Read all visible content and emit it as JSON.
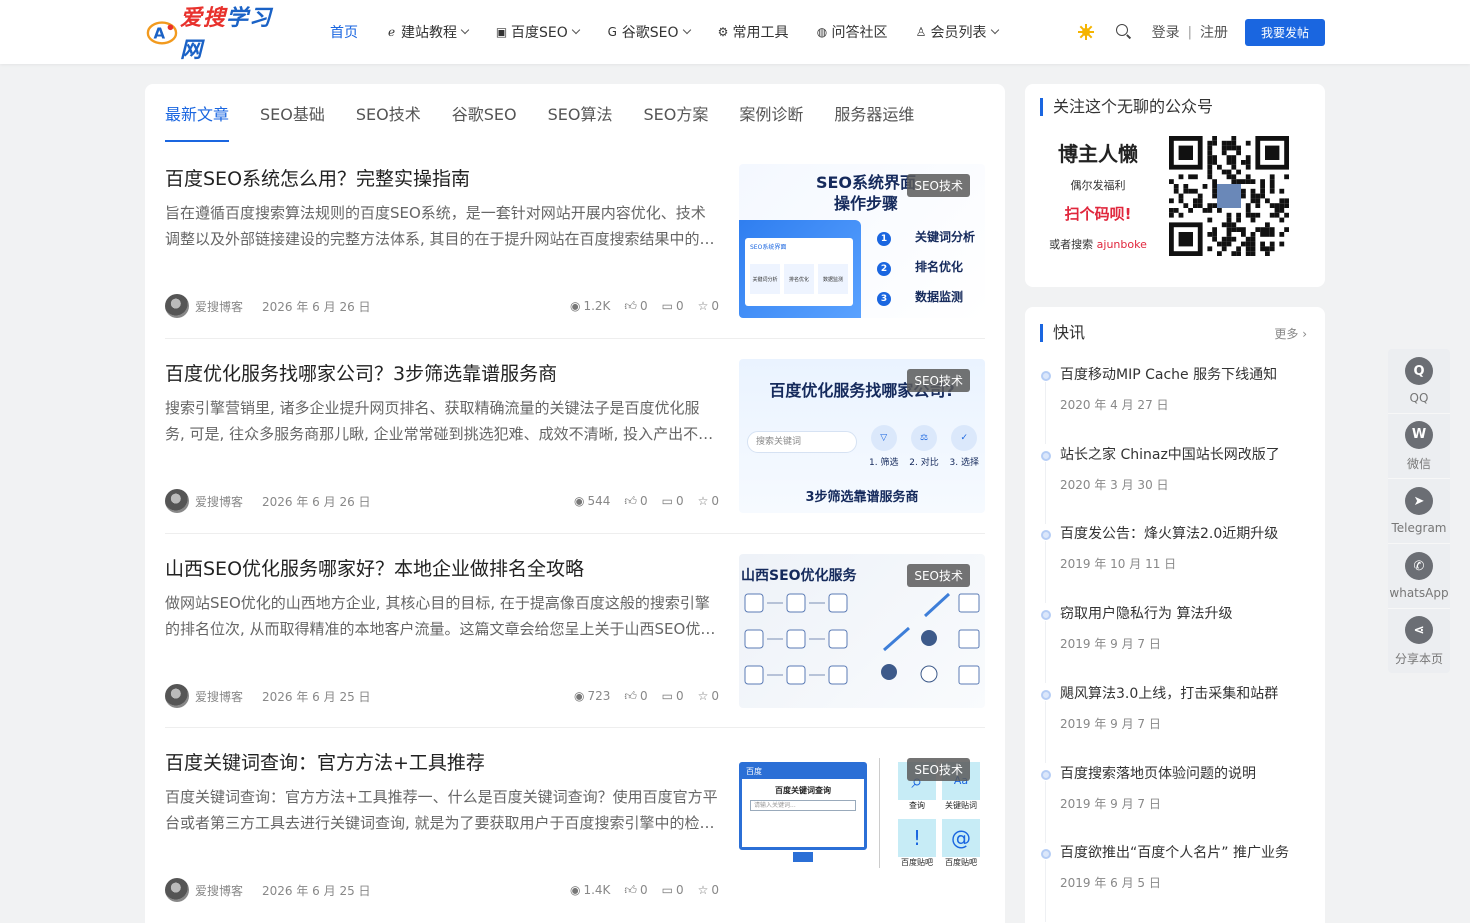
{
  "logo": {
    "brand_a": "爱搜",
    "brand_b": "学习网",
    "mark": "A"
  },
  "nav": [
    {
      "label": "首页",
      "icon": "",
      "caret": false,
      "active": true
    },
    {
      "label": "建站教程",
      "icon": "ℯ",
      "caret": true
    },
    {
      "label": "百度SEO",
      "icon": "▣",
      "caret": true
    },
    {
      "label": "谷歌SEO",
      "icon": "G",
      "caret": true
    },
    {
      "label": "常用工具",
      "icon": "⚙",
      "caret": false
    },
    {
      "label": "问答社区",
      "icon": "◍",
      "caret": false
    },
    {
      "label": "会员列表",
      "icon": "♙",
      "caret": true
    }
  ],
  "header": {
    "login": "登录",
    "sep": "|",
    "register": "注册",
    "post_button": "我要发帖"
  },
  "tabs": [
    "最新文章",
    "SEO基础",
    "SEO技术",
    "谷歌SEO",
    "SEO算法",
    "SEO方案",
    "案例诊断",
    "服务器运维"
  ],
  "posts": [
    {
      "title": "百度SEO系统怎么用？完整实操指南",
      "excerpt": "旨在遵循百度搜索算法规则的百度SEO系统，是一套针对网站开展内容优化、技术调整以及外部链接建设的完整方法体系, 其目的在于提升网站在百度搜索结果中的排名表现...",
      "author": "爱搜博客",
      "date": "2026 年 6 月 26 日",
      "views": "1.2K",
      "likes": "0",
      "comments": "0",
      "favs": "0",
      "badge": "SEO技术",
      "thumb": {
        "title_1": "SEO系统界面",
        "title_2": "操作步骤",
        "steps": [
          "关键词分析",
          "排名优化",
          "数据监测"
        ],
        "nums": [
          "1",
          "2",
          "3"
        ],
        "ui_title": "SEO系统界面",
        "ui_cards": [
          "关键词分析",
          "排名优化",
          "数据监测"
        ]
      }
    },
    {
      "title": "百度优化服务找哪家公司？3步筛选靠谱服务商",
      "excerpt": "搜索引擎营销里, 诸多企业提升网页排名、获取精确流量的关键法子是百度优化服务, 可是, 往众多服务商那儿瞅, 企业常常碰到挑选犯难、成效不清晰, 投入产出不成正比等问题...",
      "author": "爱搜博客",
      "date": "2026 年 6 月 26 日",
      "views": "544",
      "likes": "0",
      "comments": "0",
      "favs": "0",
      "badge": "SEO技术",
      "thumb": {
        "title": "百度优化服务找哪家公司?",
        "search_ph": "搜索关键词",
        "steps": [
          "1. 筛选",
          "2. 对比",
          "3. 选择"
        ],
        "footer": "3步筛选靠谱服务商"
      }
    },
    {
      "title": "山西SEO优化服务哪家好？本地企业做排名全攻略",
      "excerpt": "做网站SEO优化的山西地方企业, 其核心目的目标, 在于提高像百度这般的搜索引擎的排名位次, 从而取得精准的本地客户流量。这篇文章会给您呈上关于山西SEO优化服务的全面攻略...",
      "author": "爱搜博客",
      "date": "2026 年 6 月 25 日",
      "views": "723",
      "likes": "0",
      "comments": "0",
      "favs": "0",
      "badge": "SEO技术",
      "thumb": {
        "title": "山西SEO优化服务"
      }
    },
    {
      "title": "百度关键词查询：官方方法+工具推荐",
      "excerpt": "百度关键词查询：官方方法+工具推荐一、什么是百度关键词查询？使用百度官方平台或者第三方工具去进行关键词查询, 就是为了要获取用户于百度搜索引擎中的检索数据...",
      "author": "爱搜博客",
      "date": "2026 年 6 月 25 日",
      "views": "1.4K",
      "likes": "0",
      "comments": "0",
      "favs": "0",
      "badge": "SEO技术",
      "thumb": {
        "brand": "百度",
        "panel_title": "百度关键词查询",
        "input_ph": "请输入关键词...",
        "tools": [
          "查询",
          "关键贴词",
          "百度贴吧",
          "百度贴吧"
        ]
      }
    }
  ],
  "sidebar": {
    "follow_title": "关注这个无聊的公众号",
    "qr": {
      "line1": "博主人懒",
      "line2": "偶尔发福利",
      "line3": "扫个码呗!",
      "line4_a": "或者搜索",
      "line4_b": "ajunboke"
    },
    "flash_title": "快讯",
    "more": "更多",
    "flash": [
      {
        "title": "百度移动MIP Cache 服务下线通知",
        "date": "2020 年 4 月 27 日"
      },
      {
        "title": "站长之家 Chinaz中国站长网改版了",
        "date": "2020 年 3 月 30 日"
      },
      {
        "title": "百度发公告：烽火算法2.0近期升级",
        "date": "2019 年 10 月 11 日"
      },
      {
        "title": "窃取用户隐私行为 算法升级",
        "date": "2019 年 9 月 7 日"
      },
      {
        "title": "飓风算法3.0上线，打击采集和站群",
        "date": "2019 年 9 月 7 日"
      },
      {
        "title": "百度搜索落地页体验问题的说明",
        "date": "2019 年 9 月 7 日"
      },
      {
        "title": "百度欲推出“百度个人名片” 推广业务",
        "date": "2019 年 6 月 5 日"
      }
    ]
  },
  "float_bar": [
    {
      "label": "QQ",
      "icon": "qq-icon",
      "glyph": "Q"
    },
    {
      "label": "微信",
      "icon": "wechat-icon",
      "glyph": "W"
    },
    {
      "label": "Telegram",
      "icon": "telegram-icon",
      "glyph": "➤"
    },
    {
      "label": "whatsApp",
      "icon": "whatsapp-icon",
      "glyph": "✆"
    },
    {
      "label": "分享本页",
      "icon": "share-icon",
      "glyph": "⋖"
    }
  ],
  "colors": {
    "accent": "#1a66e0",
    "badge_bg": "#5a5a5a",
    "qr_red": "#e0263c"
  }
}
